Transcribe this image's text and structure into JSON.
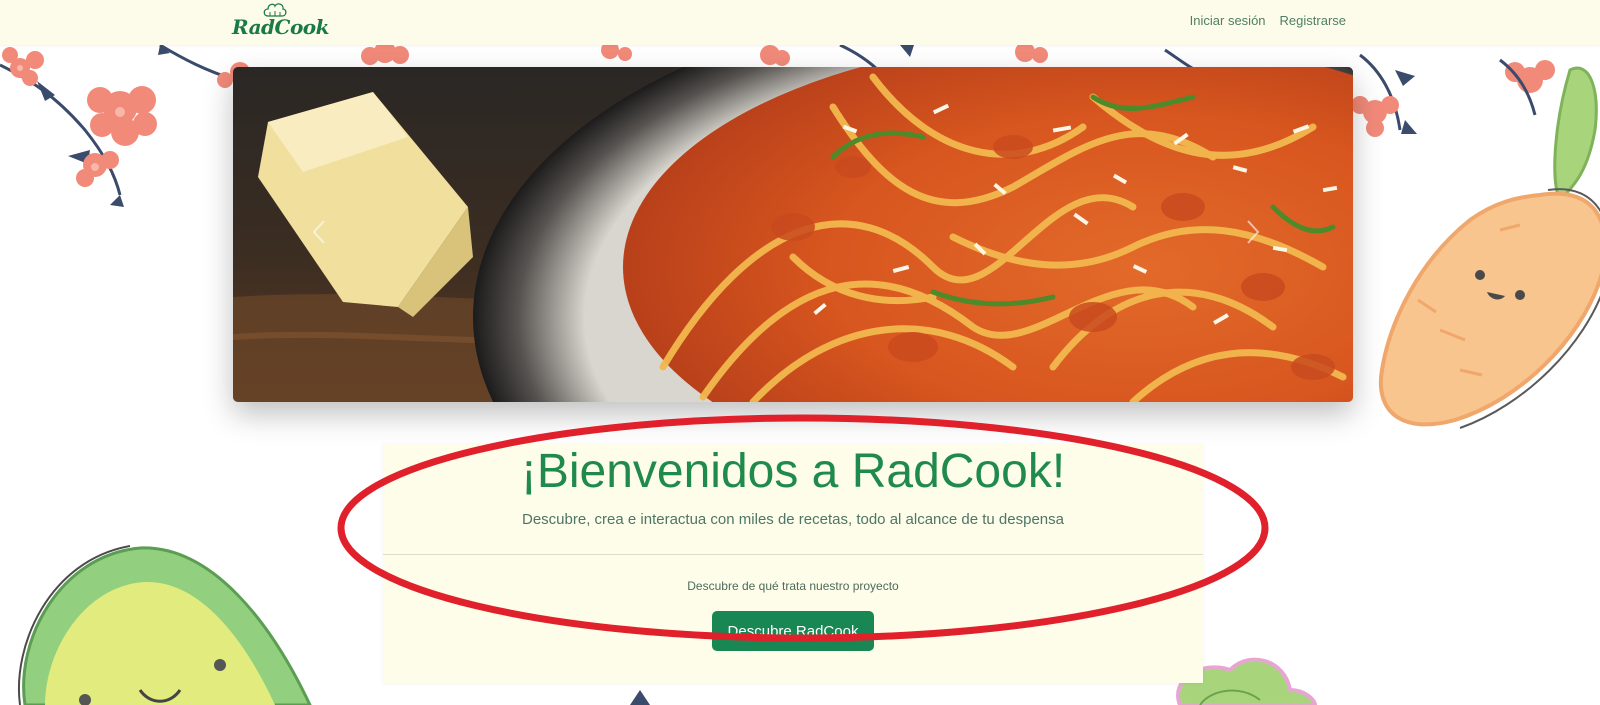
{
  "brand": {
    "name": "RadCook"
  },
  "nav": {
    "login": "Iniciar sesión",
    "register": "Registrarse"
  },
  "welcome": {
    "title": "¡Bienvenidos a RadCook!",
    "subtitle": "Descubre, crea e interactua con miles de recetas, todo al alcance de tu despensa",
    "project_text": "Descubre de qué trata nuestro proyecto",
    "cta_label": "Descubre RadCook"
  },
  "colors": {
    "accent": "#198754",
    "title_green": "#1f8a4c",
    "navbar_bg": "#fdfcea",
    "card_bg": "#fdfdea",
    "annotation_red": "#e0202a"
  },
  "icons": {
    "brand_logo": "chef-hat-icon",
    "carousel_prev": "chevron-left-icon",
    "carousel_next": "chevron-right-icon"
  }
}
